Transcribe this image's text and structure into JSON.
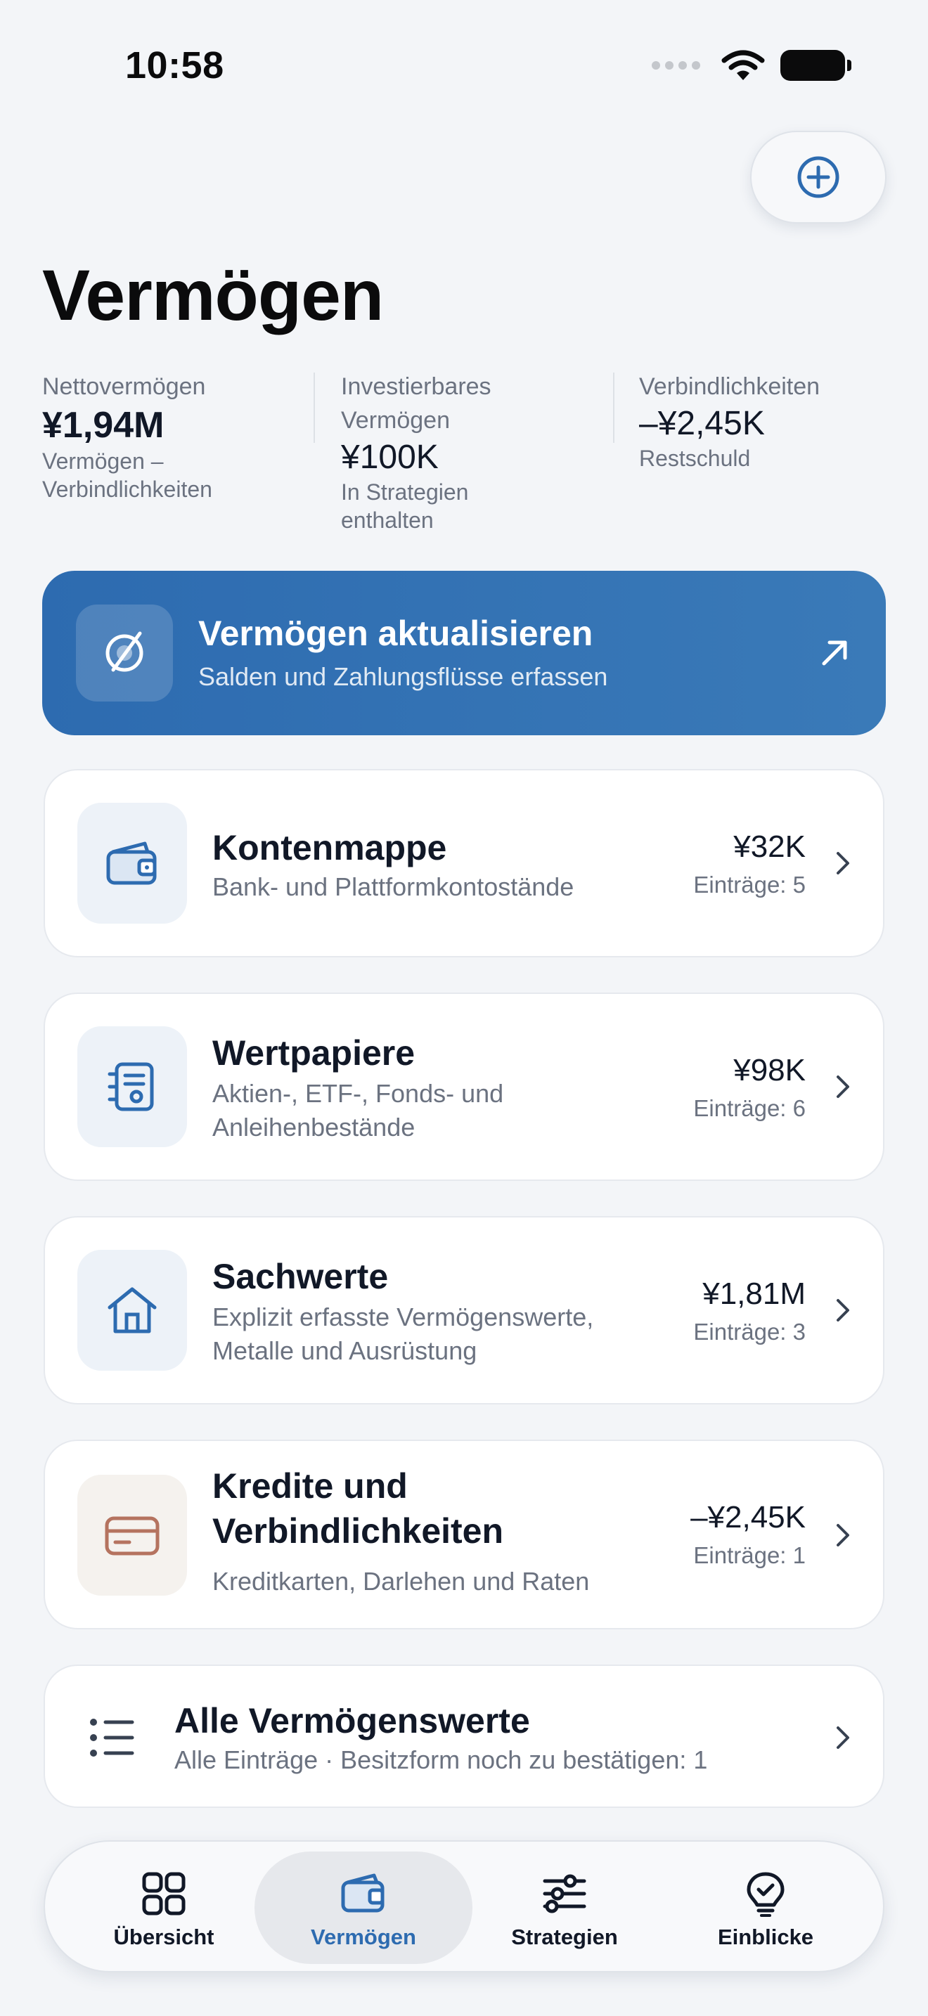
{
  "status_bar": {
    "time": "10:58"
  },
  "page": {
    "title": "Vermögen"
  },
  "summary": [
    {
      "label": "Nettovermögen",
      "value": "¥1,94M",
      "sub": "Vermögen – Verbindlichkeiten"
    },
    {
      "label": "Investierbares Vermögen",
      "value": "¥100K",
      "sub": "In Strategien enthalten"
    },
    {
      "label": "Verbindlichkeiten",
      "value": "–¥2,45K",
      "sub": "Restschuld"
    }
  ],
  "banner": {
    "title": "Vermögen aktualisieren",
    "subtitle": "Salden und Zahlungsflüsse erfassen",
    "icon": "refresh-orbit-icon"
  },
  "cards": [
    {
      "title": "Kontenmappe",
      "subtitle": "Bank- und Plattformkontostände",
      "amount": "¥32K",
      "count": "Einträge: 5",
      "icon": "wallet-icon"
    },
    {
      "title": "Wertpapiere",
      "subtitle": "Aktien-, ETF-, Fonds- und Anleihenbestände",
      "amount": "¥98K",
      "count": "Einträge: 6",
      "icon": "notebook-icon"
    },
    {
      "title": "Sachwerte",
      "subtitle": "Explizit erfasste Vermögenswerte, Metalle und Ausrüstung",
      "amount": "¥1,81M",
      "count": "Einträge: 3",
      "icon": "house-icon"
    },
    {
      "title": "Kredite und Verbindlichkeiten",
      "subtitle": "Kreditkarten, Darlehen und Raten",
      "amount": "–¥2,45K",
      "count": "Einträge: 1",
      "icon": "credit-card-icon"
    }
  ],
  "all_assets": {
    "title": "Alle Vermögenswerte",
    "subtitle": "Alle Einträge · Besitzform noch zu bestätigen: 1",
    "icon": "list-icon"
  },
  "tabs": [
    {
      "label": "Übersicht",
      "icon": "grid-icon",
      "active": false
    },
    {
      "label": "Vermögen",
      "icon": "wallet-icon",
      "active": true
    },
    {
      "label": "Strategien",
      "icon": "sliders-icon",
      "active": false
    },
    {
      "label": "Einblicke",
      "icon": "lightbulb-icon",
      "active": false
    }
  ],
  "colors": {
    "accent": "#2d6bb0",
    "background": "#f3f5f8",
    "card": "#ffffff",
    "muted_text": "#6b7280",
    "debt_icon": "#b5735f"
  }
}
